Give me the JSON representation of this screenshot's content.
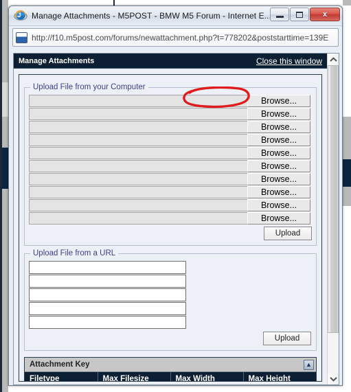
{
  "window": {
    "title": "Manage Attachments - M5POST - BMW M5 Forum - Internet E...",
    "browser_icon": "internet-explorer-icon",
    "minimize_label": "",
    "maximize_label": "",
    "close_label": "x"
  },
  "address": {
    "icon": "page-icon",
    "url": "http://f10.m5post.com/forums/newattachment.php?t=778202&poststarttime=139E"
  },
  "header": {
    "title": "Manage Attachments",
    "close_link": "Close this window"
  },
  "upload_from_computer": {
    "legend": "Upload File from your Computer",
    "rows": [
      {
        "value": "",
        "browse_label": "Browse..."
      },
      {
        "value": "",
        "browse_label": "Browse..."
      },
      {
        "value": "",
        "browse_label": "Browse..."
      },
      {
        "value": "",
        "browse_label": "Browse..."
      },
      {
        "value": "",
        "browse_label": "Browse..."
      },
      {
        "value": "",
        "browse_label": "Browse..."
      },
      {
        "value": "",
        "browse_label": "Browse..."
      },
      {
        "value": "",
        "browse_label": "Browse..."
      },
      {
        "value": "",
        "browse_label": "Browse..."
      },
      {
        "value": "",
        "browse_label": "Browse..."
      }
    ],
    "upload_label": "Upload"
  },
  "upload_from_url": {
    "legend": "Upload File from a URL",
    "rows": [
      {
        "value": ""
      },
      {
        "value": ""
      },
      {
        "value": ""
      },
      {
        "value": ""
      },
      {
        "value": ""
      }
    ],
    "upload_label": "Upload"
  },
  "attachment_key": {
    "title": "Attachment Key",
    "collapse_icon": "collapse-icon",
    "columns": [
      "Filetype",
      "Max Filesize",
      "Max Width",
      "Max Height"
    ],
    "rows": []
  },
  "scrollbar": {
    "up_icon": "chevron-up-icon",
    "down_icon": "chevron-down-icon"
  },
  "annotation": {
    "shape": "red-ellipse",
    "color": "#e01b1b",
    "targets": "browse-button-1"
  }
}
